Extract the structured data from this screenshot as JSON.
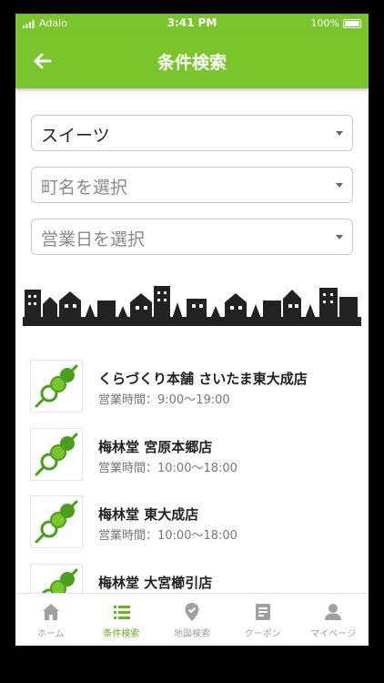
{
  "status_bar": {
    "carrier": "Adalo",
    "time": "3:41 PM",
    "battery": "100%"
  },
  "header": {
    "title": "条件検索",
    "back_icon": "arrow-left-icon"
  },
  "filters": [
    {
      "value": "スイーツ",
      "placeholder": false
    },
    {
      "value": "町名を選択",
      "placeholder": true
    },
    {
      "value": "営業日を選択",
      "placeholder": true
    }
  ],
  "shops": [
    {
      "name": "くらづくり本舗 さいたま東大成店",
      "hours": "営業時間：9:00〜19:00"
    },
    {
      "name": "梅林堂 宮原本郷店",
      "hours": "営業時間：10:00〜18:00"
    },
    {
      "name": "梅林堂 東大成店",
      "hours": "営業時間：10:00〜18:00"
    },
    {
      "name": "梅林堂 大宮櫛引店",
      "hours": ""
    }
  ],
  "tabs": [
    {
      "label": "ホーム",
      "icon": "home-icon",
      "active": false
    },
    {
      "label": "条件検索",
      "icon": "list-icon",
      "active": true
    },
    {
      "label": "地図検索",
      "icon": "map-pin-icon",
      "active": false
    },
    {
      "label": "クーポン",
      "icon": "coupon-icon",
      "active": false
    },
    {
      "label": "マイページ",
      "icon": "person-icon",
      "active": false
    }
  ],
  "colors": {
    "primary": "#7bc52c",
    "tab_active": "#6ab024",
    "tab_inactive": "#a0a0a0",
    "dango_green": "#4a9e1c"
  }
}
